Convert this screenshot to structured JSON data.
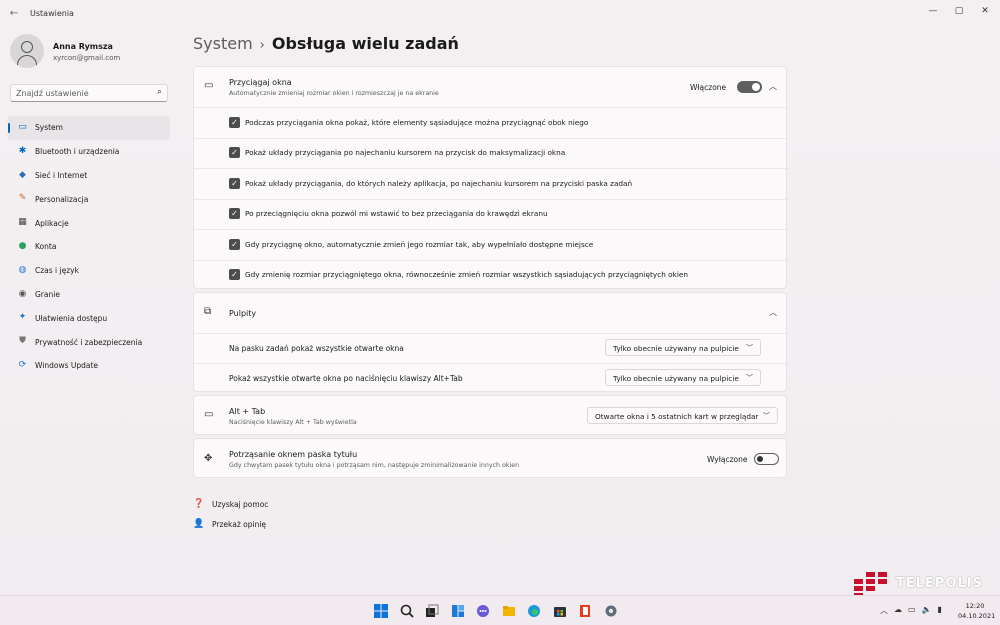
{
  "window": {
    "app_title": "Ustawienia",
    "back_icon": "back-arrow-icon",
    "controls": {
      "minimize": "—",
      "maximize": "▢",
      "close": "✕"
    }
  },
  "profile": {
    "name": "Anna Rymsza",
    "email": "xyrcon@gmail.com"
  },
  "search": {
    "placeholder": "Znajdź ustawienie"
  },
  "nav": {
    "items": [
      {
        "label": "System",
        "icon": "monitor-icon",
        "glyph": "▭",
        "color": "#0067c0",
        "active": true
      },
      {
        "label": "Bluetooth i urządzenia",
        "icon": "bluetooth-icon",
        "glyph": "✱",
        "color": "#0067c0"
      },
      {
        "label": "Sieć i Internet",
        "icon": "wifi-icon",
        "glyph": "◆",
        "color": "#2f6fb8"
      },
      {
        "label": "Personalizacja",
        "icon": "brush-icon",
        "glyph": "✎",
        "color": "#c56a2a"
      },
      {
        "label": "Aplikacje",
        "icon": "apps-icon",
        "glyph": "▦",
        "color": "#444"
      },
      {
        "label": "Konta",
        "icon": "account-icon",
        "glyph": "●",
        "color": "#2aa05c"
      },
      {
        "label": "Czas i język",
        "icon": "globe-icon",
        "glyph": "◍",
        "color": "#2b7cd3"
      },
      {
        "label": "Granie",
        "icon": "gamepad-icon",
        "glyph": "◉",
        "color": "#555"
      },
      {
        "label": "Ułatwienia dostępu",
        "icon": "accessibility-icon",
        "glyph": "✦",
        "color": "#1a73c9"
      },
      {
        "label": "Prywatność i zabezpieczenia",
        "icon": "shield-icon",
        "glyph": "⛊",
        "color": "#777"
      },
      {
        "label": "Windows Update",
        "icon": "update-icon",
        "glyph": "⟳",
        "color": "#1a73c9"
      }
    ]
  },
  "breadcrumb": {
    "parent": "System",
    "separator": "›",
    "current": "Obsługa wielu zadań"
  },
  "snap": {
    "title": "Przyciągaj okna",
    "subtitle": "Automatycznie zmieniaj rozmiar okien i rozmieszczaj je na ekranie",
    "toggle_label": "Włączone",
    "toggle_on": true,
    "options": [
      "Podczas przyciągania okna pokaż, które elementy sąsiadujące można przyciągnąć obok niego",
      "Pokaż układy przyciągania po najechaniu kursorem na przycisk do maksymalizacji okna",
      "Pokaż układy przyciągania, do których należy aplikacja, po najechaniu kursorem na przyciski paska zadań",
      "Po przeciągnięciu okna pozwól mi wstawić to bez przeciągania do krawędzi ekranu",
      "Gdy przyciągnę okno, automatycznie zmień jego rozmiar tak, aby wypełniało dostępne miejsce",
      "Gdy zmienię rozmiar przyciągniętego okna, równocześnie zmień rozmiar wszystkich sąsiadujących przyciągniętych okien"
    ]
  },
  "desktops": {
    "title": "Pulpity",
    "rows": [
      {
        "label": "Na pasku zadań pokaż wszystkie otwarte okna",
        "value": "Tylko obecnie używany na pulpicie"
      },
      {
        "label": "Pokaż wszystkie otwarte okna po naciśnięciu klawiszy Alt+Tab",
        "value": "Tylko obecnie używany na pulpicie"
      }
    ]
  },
  "alttab": {
    "title": "Alt + Tab",
    "subtitle": "Naciśnięcie klawiszy Alt + Tab wyświetla",
    "value": "Otwarte okna i 5 ostatnich kart w przeglądar"
  },
  "shake": {
    "title": "Potrząsanie oknem paska tytułu",
    "subtitle": "Gdy chwytam pasek tytułu okna i potrząsam nim, następuje zminimalizowanie innych okien",
    "toggle_label": "Wyłączone",
    "toggle_on": false
  },
  "links": {
    "help": "Uzyskaj pomoc",
    "feedback": "Przekaż opinię"
  },
  "watermark": {
    "text": "TELEPOLIS"
  },
  "taskbar": {
    "icons": [
      "windows-start-icon",
      "search-icon",
      "task-view-icon",
      "widgets-icon",
      "chat-icon",
      "file-explorer-icon",
      "edge-icon",
      "store-icon",
      "office-icon",
      "settings-icon"
    ],
    "time": "12:20",
    "date": "04.10.2021"
  }
}
